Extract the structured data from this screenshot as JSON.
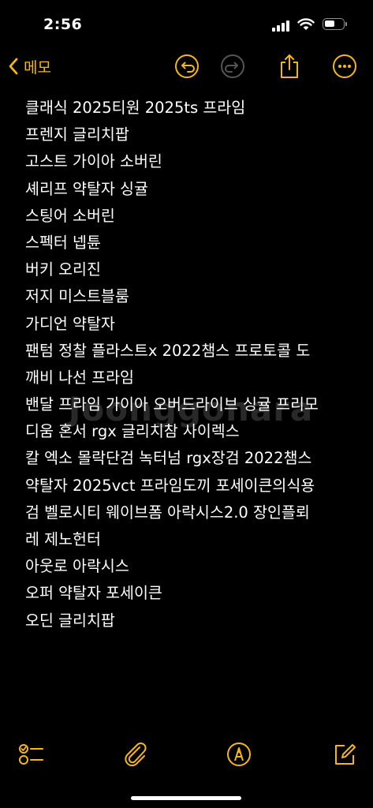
{
  "status_bar": {
    "time": "2:56",
    "battery_level": 0.55
  },
  "nav": {
    "back_label": "메모"
  },
  "note": {
    "lines": [
      "클래식 2025티원 2025ts 프라임",
      "프렌지 글리치팝",
      "고스트 가이아 소버린",
      "셰리프 약탈자 싱귤",
      "스팅어 소버린",
      "스펙터 넵튠",
      "버키 오리진",
      "저지 미스트블룸",
      "가디언 약탈자",
      "팬텀 정찰 플라스트x 2022챔스 프로토콜 도",
      "깨비 나선 프라임",
      "밴달 프라임 가이아 오버드라이브 싱귤 프리모",
      "디움 혼서 rgx 글리치참 사이렉스",
      "칼 엑소 몰락단검 녹터넘 rgx장검 2022챔스",
      "약탈자 2025vct 프라임도끼 포세이큰의식용",
      "검 벨로시티 웨이브폼 아락시스2.0 장인플뢰",
      "레 제노헌터",
      "아웃로 아락시스",
      "오퍼 약탈자 포세이큰",
      "오딘 글리치팝"
    ]
  },
  "watermark": "Joonggonara",
  "colors": {
    "accent": "#f5b812",
    "background": "#000000",
    "text": "#ffffff"
  },
  "icons": {
    "back": "chevron-left-icon",
    "undo": "undo-icon",
    "redo": "redo-icon",
    "share": "share-icon",
    "more": "more-icon",
    "checklist": "checklist-icon",
    "attach": "paperclip-icon",
    "markup": "markup-pen-icon",
    "compose": "compose-icon"
  }
}
